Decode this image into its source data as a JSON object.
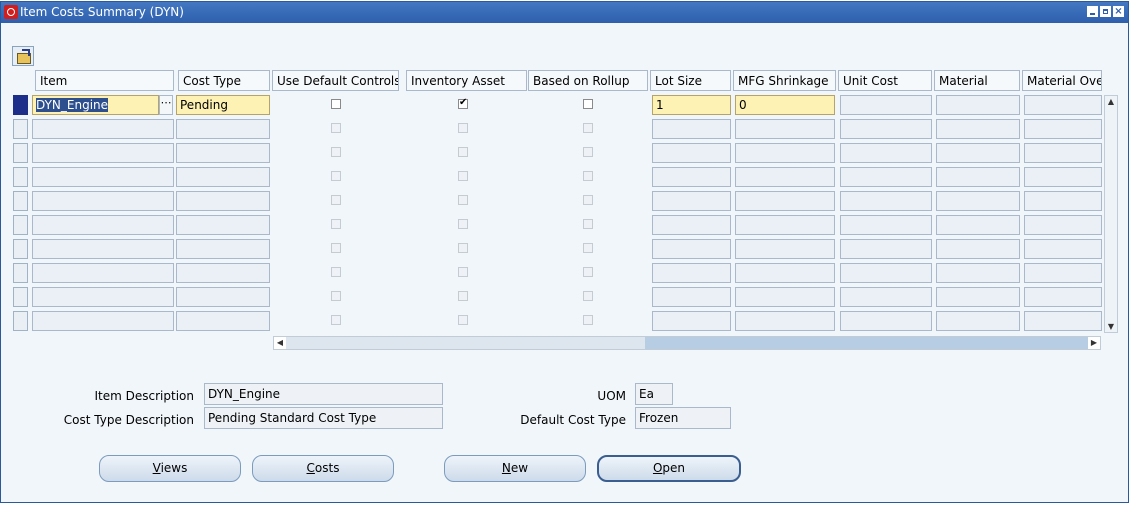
{
  "window": {
    "title": "Item Costs Summary (DYN)"
  },
  "toolbar": {
    "icon": "open-folder-icon"
  },
  "table": {
    "headers": {
      "item": "Item",
      "cost_type": "Cost Type",
      "use_default_controls": "Use Default Controls",
      "inventory_asset": "Inventory Asset",
      "based_on_rollup": "Based on Rollup",
      "lot_size": "Lot Size",
      "mfg_shrinkage": "MFG Shrinkage",
      "unit_cost": "Unit Cost",
      "material": "Material",
      "material_overhead": "Material Over"
    },
    "rows": [
      {
        "item": "DYN_Engine",
        "cost_type": "Pending",
        "use_default_controls": false,
        "inventory_asset": true,
        "based_on_rollup": false,
        "lot_size": "1",
        "mfg_shrinkage": "0"
      }
    ],
    "visible_row_count": 10
  },
  "details": {
    "item_description_label": "Item Description",
    "item_description": "DYN_Engine",
    "cost_type_description_label": "Cost Type Description",
    "cost_type_description": "Pending Standard Cost Type",
    "uom_label": "UOM",
    "uom": "Ea",
    "default_cost_type_label": "Default Cost Type",
    "default_cost_type": "Frozen"
  },
  "buttons": {
    "views_first": "V",
    "views_rest": "iews",
    "costs_first": "C",
    "costs_rest": "osts",
    "new_first": "N",
    "new_rest": "ew",
    "open_first": "O",
    "open_rest": "pen"
  }
}
